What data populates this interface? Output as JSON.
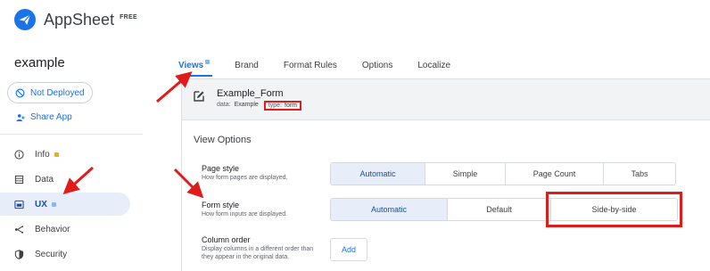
{
  "header": {
    "app_name": "AppSheet",
    "plan_badge": "FREE",
    "logo_color": "#1a73e8"
  },
  "sidebar": {
    "app_title": "example",
    "deploy_status": "Not Deployed",
    "share_label": "Share App",
    "items": [
      {
        "label": "Info",
        "icon": "info-icon",
        "badge": "orange"
      },
      {
        "label": "Data",
        "icon": "database-icon"
      },
      {
        "label": "UX",
        "icon": "ux-icon",
        "badge": "blue",
        "active": true
      },
      {
        "label": "Behavior",
        "icon": "behavior-icon"
      },
      {
        "label": "Security",
        "icon": "shield-icon"
      }
    ]
  },
  "tabs": [
    {
      "label": "Views",
      "active": true
    },
    {
      "label": "Brand"
    },
    {
      "label": "Format Rules"
    },
    {
      "label": "Options"
    },
    {
      "label": "Localize"
    }
  ],
  "view": {
    "name": "Example_Form",
    "data_label": "data:",
    "data_value": "Example",
    "type_label": "type:",
    "type_value": "form"
  },
  "options": {
    "section_title": "View Options",
    "page_style": {
      "label": "Page style",
      "desc": "How form pages are displayed.",
      "choices": [
        "Automatic",
        "Simple",
        "Page Count",
        "Tabs"
      ],
      "selected": "Automatic"
    },
    "form_style": {
      "label": "Form style",
      "desc": "How form inputs are displayed.",
      "choices": [
        "Automatic",
        "Default",
        "Side-by-side"
      ],
      "selected": "Automatic"
    },
    "column_order": {
      "label": "Column order",
      "desc": "Display columns in a different order than they appear in the original data.",
      "button": "Add"
    }
  },
  "colors": {
    "accent": "#1a73e8",
    "selected_bg": "#e8eef9",
    "annotation": "#e01b1b"
  }
}
